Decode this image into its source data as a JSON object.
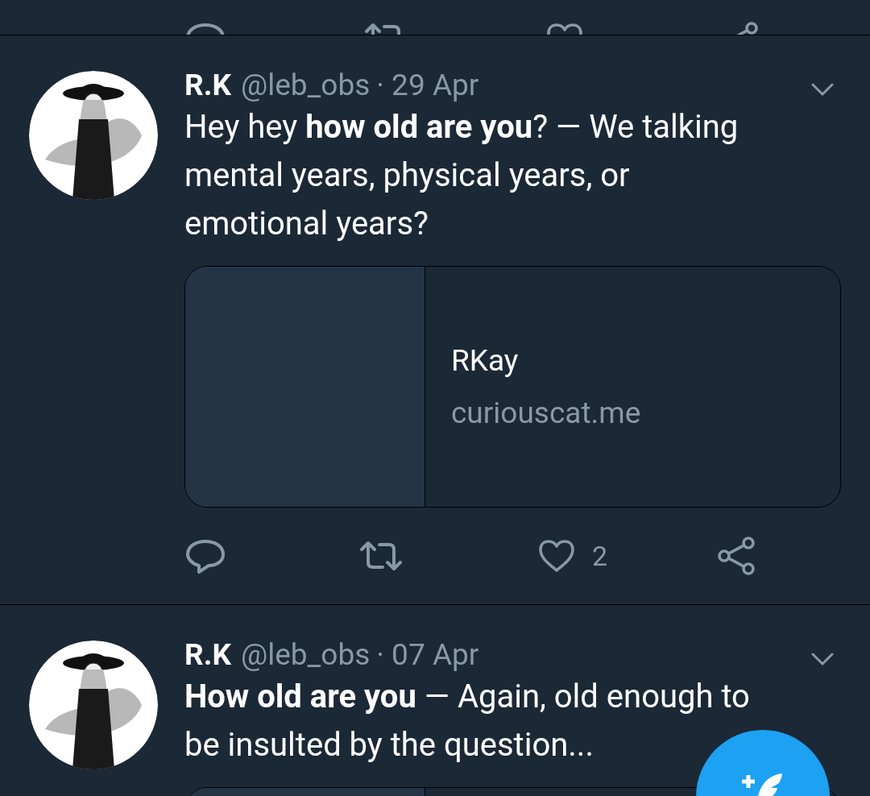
{
  "tweets": [
    {
      "name": "R.K",
      "handle": "@leb_obs",
      "date": "· 29 Apr",
      "text": "Hey hey **how old are you**? — We talking mental years, physical years, or emotional years?",
      "card": {
        "kind": "link",
        "title": "RKay",
        "domain": "curiouscat.me"
      },
      "likes": "2"
    },
    {
      "name": "R.K",
      "handle": "@leb_obs",
      "date": "· 07 Apr",
      "text": "**How old are you** — Again, old enough to be insulted by the question...",
      "card": {
        "kind": "link"
      }
    }
  ]
}
